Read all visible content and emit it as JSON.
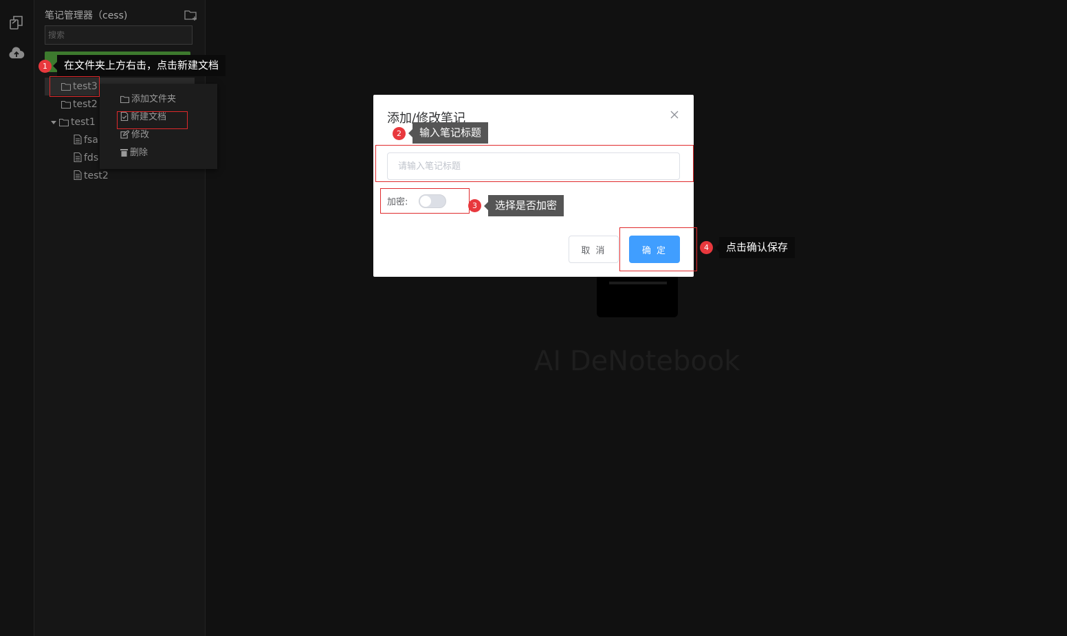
{
  "sidebar": {
    "title": "笔记管理器（cess)",
    "search_placeholder": "搜索",
    "tree": [
      {
        "label": "test3",
        "type": "folder"
      },
      {
        "label": "test2",
        "type": "folder"
      },
      {
        "label": "test1",
        "type": "folder"
      },
      {
        "label": "fsa",
        "type": "file"
      },
      {
        "label": "fds",
        "type": "file"
      },
      {
        "label": "test2",
        "type": "file"
      }
    ]
  },
  "context_menu": {
    "items": [
      {
        "label": "添加文件夹",
        "icon": "folder-icon"
      },
      {
        "label": "新建文档",
        "icon": "document-icon"
      },
      {
        "label": "修改",
        "icon": "edit-icon"
      },
      {
        "label": "删除",
        "icon": "trash-icon"
      }
    ]
  },
  "background": {
    "watermark": "AI DeNotebook"
  },
  "dialog": {
    "title": "添加/修改笔记",
    "title_placeholder": "请输入笔记标题",
    "encrypt_label": "加密:",
    "encrypt_on": false,
    "cancel_label": "取 消",
    "confirm_label": "确 定"
  },
  "annotations": [
    {
      "number": "1",
      "text": "在文件夹上方右击，点击新建文档"
    },
    {
      "number": "2",
      "text": "输入笔记标题"
    },
    {
      "number": "3",
      "text": "选择是否加密"
    },
    {
      "number": "4",
      "text": "点击确认保存"
    }
  ],
  "colors": {
    "accent": "#409eff",
    "annotation_red": "#e8383d",
    "background": "#111111"
  }
}
